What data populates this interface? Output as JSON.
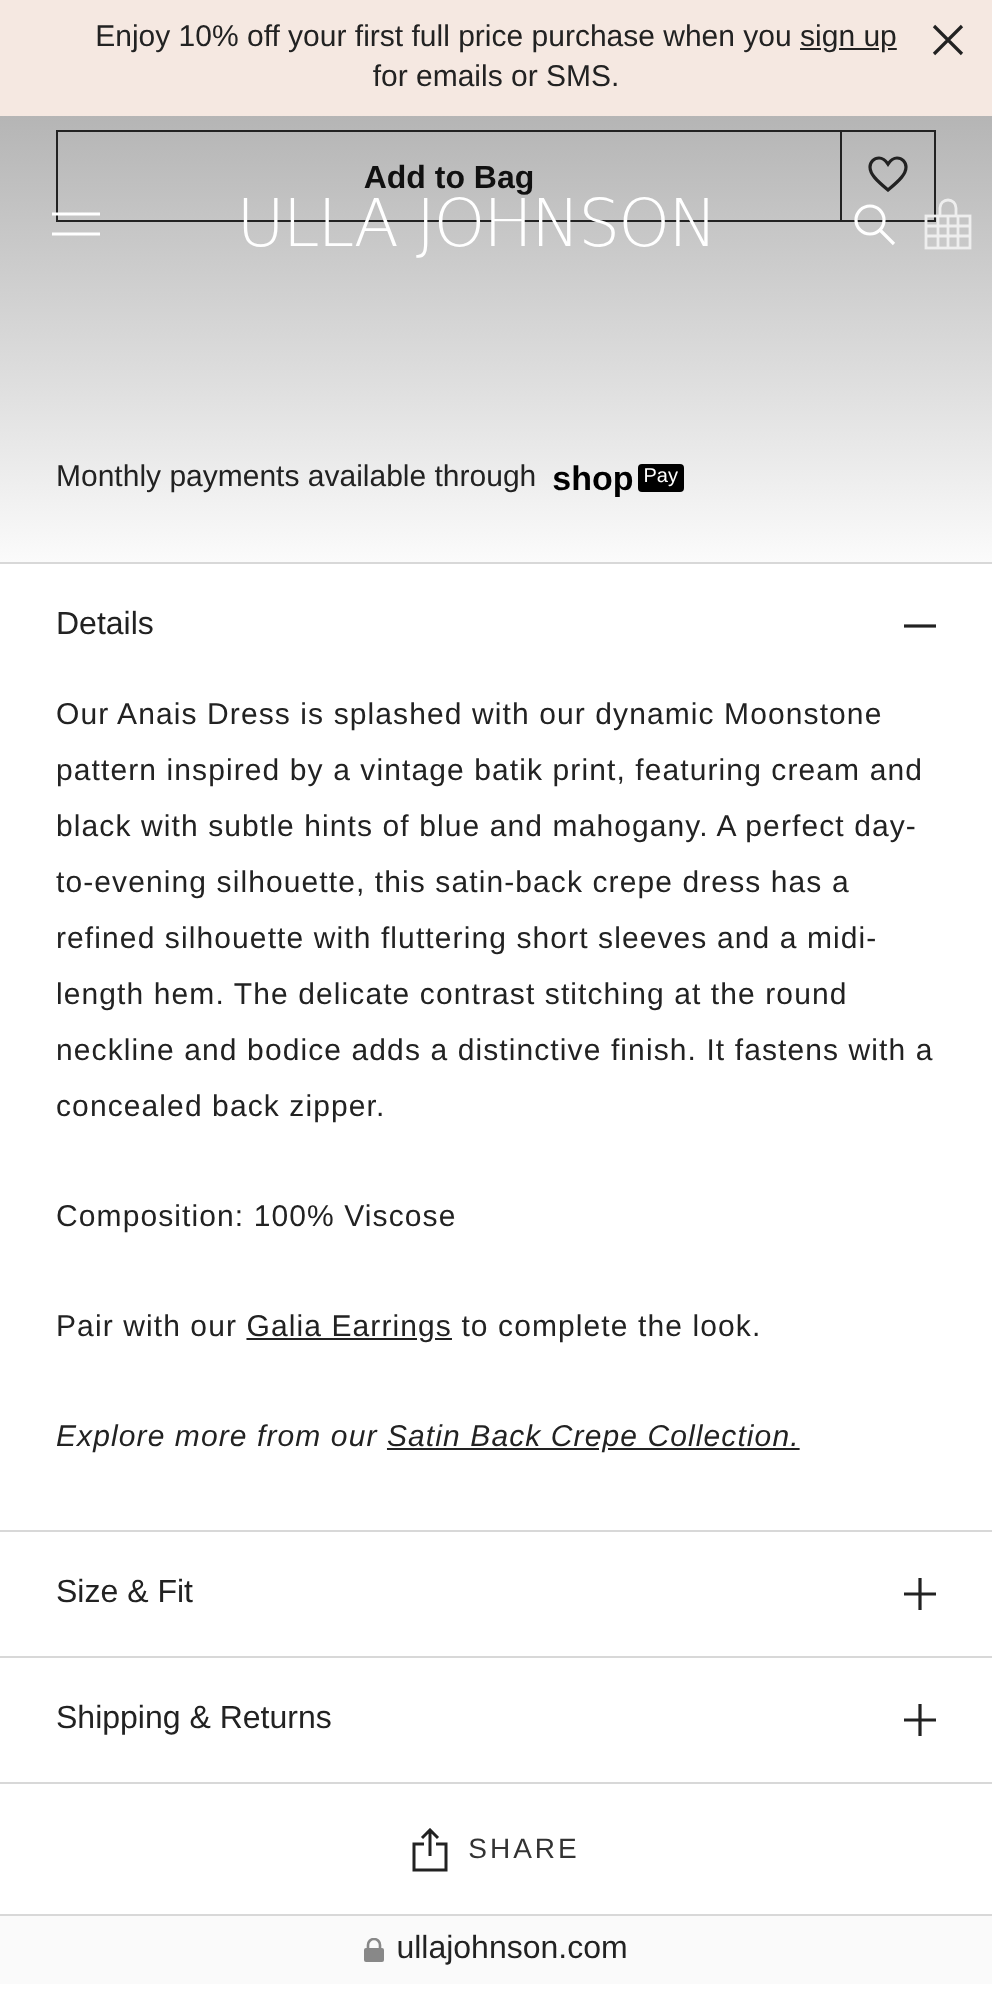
{
  "promo_banner": {
    "text": "Enjoy 10% off your first full price purchase when you",
    "link": "sign up",
    "text_after": "for emails or SMS."
  },
  "product_actions": {
    "add_to_bag": "Add to Bag"
  },
  "header": {
    "logo": "ULLA JOHNSON"
  },
  "payments_note": {
    "text": "Monthly payments available through",
    "brand": "shop",
    "badge": "Pay"
  },
  "accordion": [
    {
      "title": "Details",
      "expanded": true,
      "paragraphs": [
        {
          "kind": "plain",
          "text": "Our Anais Dress is splashed with our dynamic Moonstone pattern inspired by a vintage batik print, featuring cream and black with subtle hints of blue and mahogany. A perfect day-to-evening silhouette, this satin-back crepe dress has a refined silhouette with fluttering short sleeves and a midi-length hem. The delicate contrast stitching at the round neckline and bodice adds a distinctive finish. It fastens with a concealed back zipper."
        },
        {
          "kind": "plain",
          "text": "Composition: 100% Viscose"
        },
        {
          "kind": "link",
          "before": "Pair with our",
          "link": "Galia Earrings",
          "after": "to complete the look."
        },
        {
          "kind": "italic-link",
          "before": "Explore more from our",
          "link": "Satin Back Crepe Collection."
        }
      ]
    },
    {
      "title": "Size & Fit",
      "expanded": false
    },
    {
      "title": "Shipping & Returns",
      "expanded": false
    }
  ],
  "share": {
    "label": "SHARE"
  },
  "address_bar": {
    "url": "ullajohnson.com"
  }
}
